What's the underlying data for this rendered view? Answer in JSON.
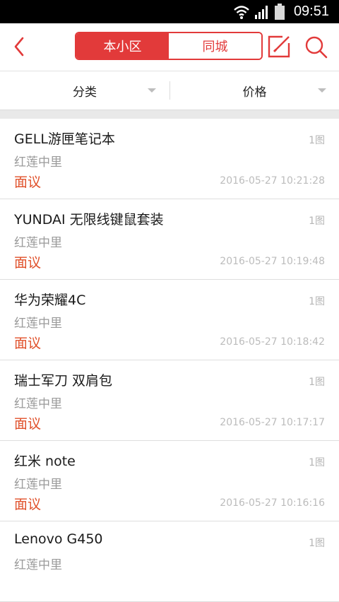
{
  "status": {
    "time": "09:51",
    "icons": [
      "wifi-icon",
      "signal-icon",
      "battery-icon"
    ]
  },
  "header": {
    "tabs": [
      {
        "label": "本小区",
        "active": true
      },
      {
        "label": "同城",
        "active": false
      }
    ],
    "accent_color": "#e23a3a",
    "icons": [
      "back-arrow-icon",
      "edit-icon",
      "search-icon"
    ]
  },
  "filters": {
    "category": "分类",
    "price": "价格"
  },
  "listings": [
    {
      "title": "GELL游匣笔记本",
      "location": "红莲中里",
      "price": "面议",
      "pics": "1图",
      "time": "2016-05-27 10:21:28"
    },
    {
      "title": "YUNDAI 无限线键鼠套装",
      "location": "红莲中里",
      "price": "面议",
      "pics": "1图",
      "time": "2016-05-27 10:19:48"
    },
    {
      "title": "华为荣耀4C",
      "location": "红莲中里",
      "price": "面议",
      "pics": "1图",
      "time": "2016-05-27 10:18:42"
    },
    {
      "title": "瑞士军刀 双肩包",
      "location": "红莲中里",
      "price": "面议",
      "pics": "1图",
      "time": "2016-05-27 10:17:17"
    },
    {
      "title": "红米 note",
      "location": "红莲中里",
      "price": "面议",
      "pics": "1图",
      "time": "2016-05-27 10:16:16"
    },
    {
      "title": "Lenovo G450",
      "location": "红莲中里",
      "price": "",
      "pics": "1图",
      "time": ""
    }
  ]
}
